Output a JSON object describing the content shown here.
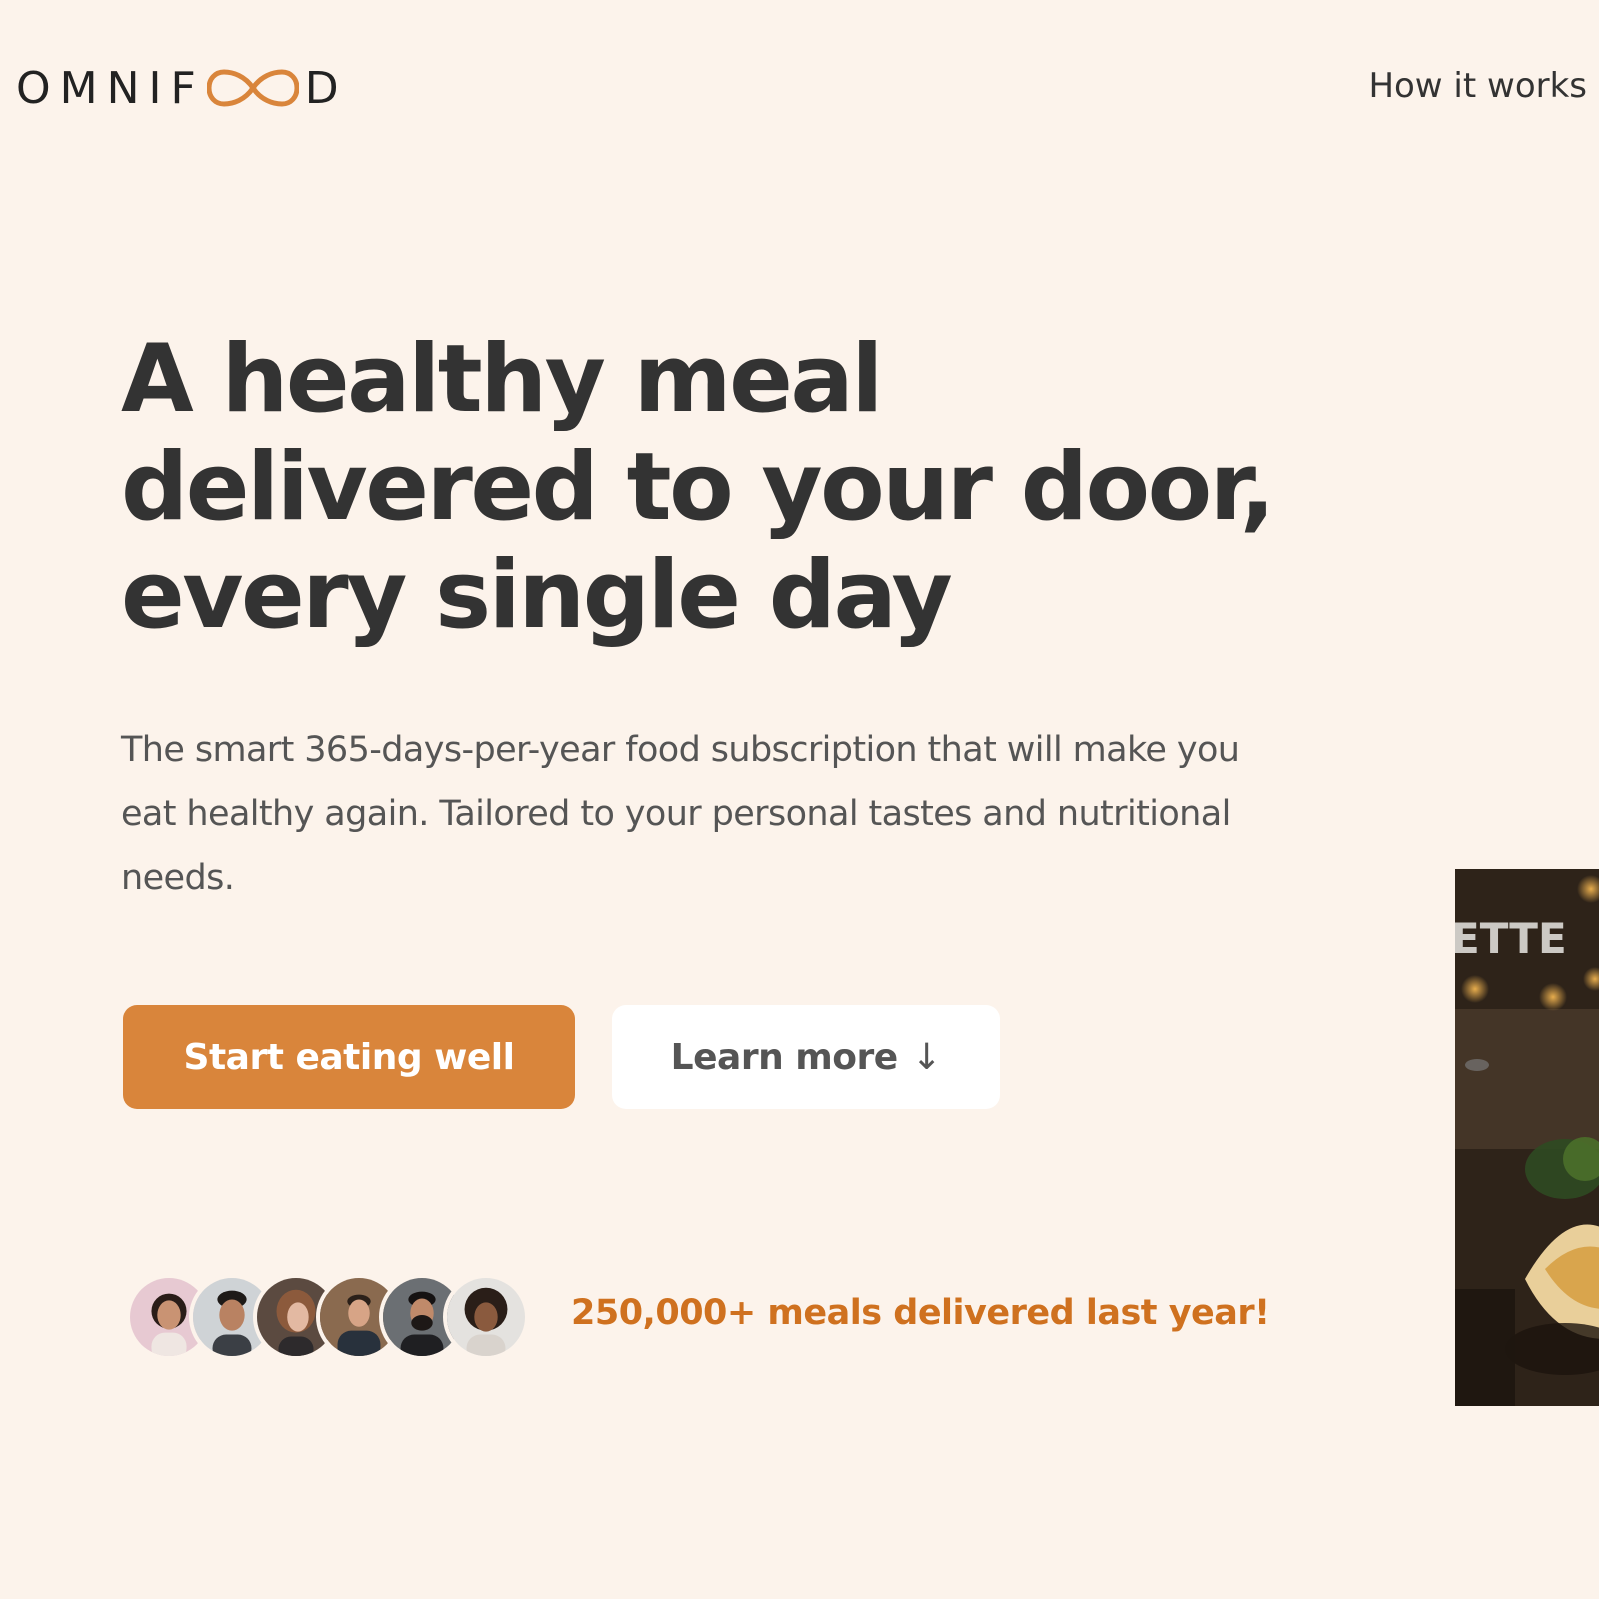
{
  "header": {
    "logo_text_left": "OMNIF",
    "logo_text_right": "D",
    "nav": {
      "how_it_works": "How it works"
    }
  },
  "hero": {
    "title_lines": [
      "A healthy meal",
      "delivered to your door,",
      "every single day"
    ],
    "description": "The smart 365-days-per-year food subscription that will make you eat healthy again. Tailored to your personal tastes and nutritional needs.",
    "primary_button": "Start eating well",
    "secondary_button": "Learn more",
    "secondary_button_icon": "↓",
    "meals_delivered": "250,000+ meals delivered last year!",
    "image_sign_text": "ETTE"
  },
  "colors": {
    "background": "#fcf3eb",
    "accent": "#d9853b",
    "accent_text": "#cf711f",
    "heading": "#333333",
    "body": "#555555"
  },
  "icons": {
    "logo": "infinity-logo-icon",
    "arrow": "arrow-down-icon"
  }
}
